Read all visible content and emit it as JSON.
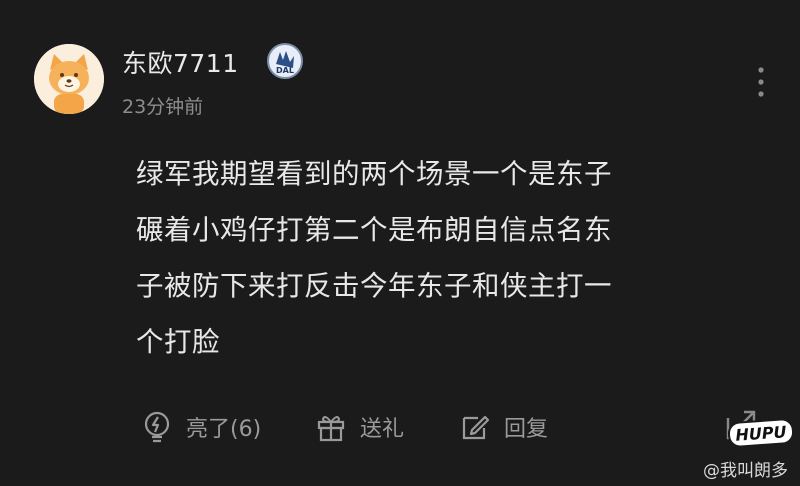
{
  "post": {
    "username": "东欧7711",
    "timestamp": "23分钟前",
    "team_badge_text": "DAL",
    "content": "绿军我期望看到的两个场景一个是东子\n碾着小鸡仔打第二个是布朗自信点名东\n子被防下来打反击今年东子和侠主打一\n个打脸"
  },
  "actions": {
    "like_label": "亮了(6)",
    "gift_label": "送礼",
    "reply_label": "回复"
  },
  "watermark": {
    "logo_text": "HUPU",
    "author": "@我叫朗多"
  }
}
